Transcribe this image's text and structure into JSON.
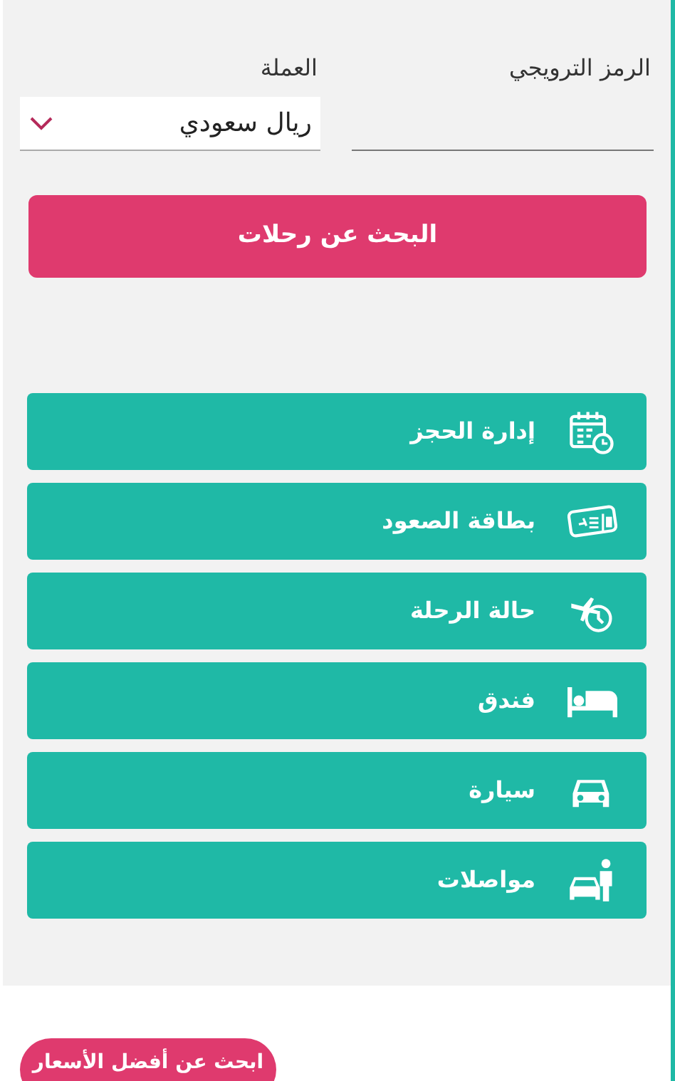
{
  "form": {
    "promo_code": {
      "label": "الرمز الترويجي"
    },
    "currency": {
      "label": "العملة",
      "value": "ريال سعودي"
    }
  },
  "search_button": "البحث عن رحلات",
  "menu": [
    {
      "label": "إدارة الحجز"
    },
    {
      "label": "بطاقة الصعود"
    },
    {
      "label": "حالة الرحلة"
    },
    {
      "label": "فندق"
    },
    {
      "label": "سيارة"
    },
    {
      "label": "مواصلات"
    }
  ],
  "best_price_button": "ابحث عن أفضل الأسعار"
}
